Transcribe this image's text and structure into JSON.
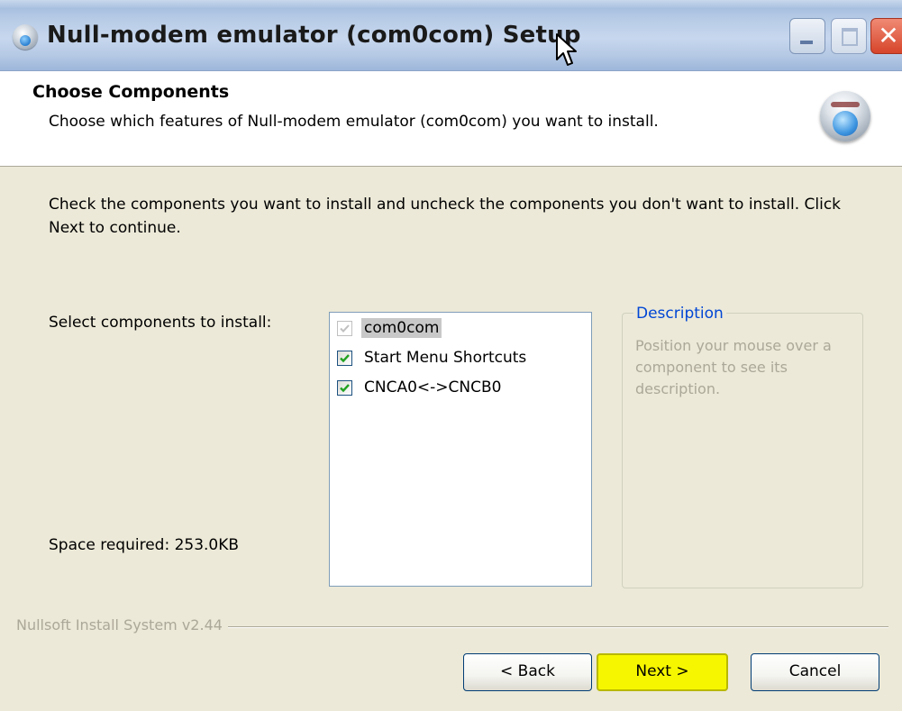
{
  "window": {
    "title": "Null-modem emulator (com0com) Setup",
    "close_glyph": "✕"
  },
  "header": {
    "title": "Choose Components",
    "subtitle": "Choose which features of Null-modem emulator (com0com) you want to install.",
    "icon": "installer-icon"
  },
  "body": {
    "instructions": "Check the components you want to install and uncheck the components you don't want to install. Click Next to continue.",
    "select_label": "Select components to install:",
    "space_required": "Space required: 253.0KB"
  },
  "components": [
    {
      "label": "com0com",
      "checked": true,
      "disabled": true,
      "selected": true
    },
    {
      "label": "Start Menu Shortcuts",
      "checked": true,
      "disabled": false,
      "selected": false
    },
    {
      "label": "CNCA0<->CNCB0",
      "checked": true,
      "disabled": false,
      "selected": false
    }
  ],
  "description": {
    "legend": "Description",
    "text": "Position your mouse over a component to see its description."
  },
  "branding": "Nullsoft Install System v2.44",
  "buttons": {
    "back": "< Back",
    "next": "Next >",
    "cancel": "Cancel"
  },
  "colors": {
    "face": "#ECE9D8",
    "next_highlight": "#F6F600",
    "legend": "#0046D5",
    "check": "#21A121"
  }
}
